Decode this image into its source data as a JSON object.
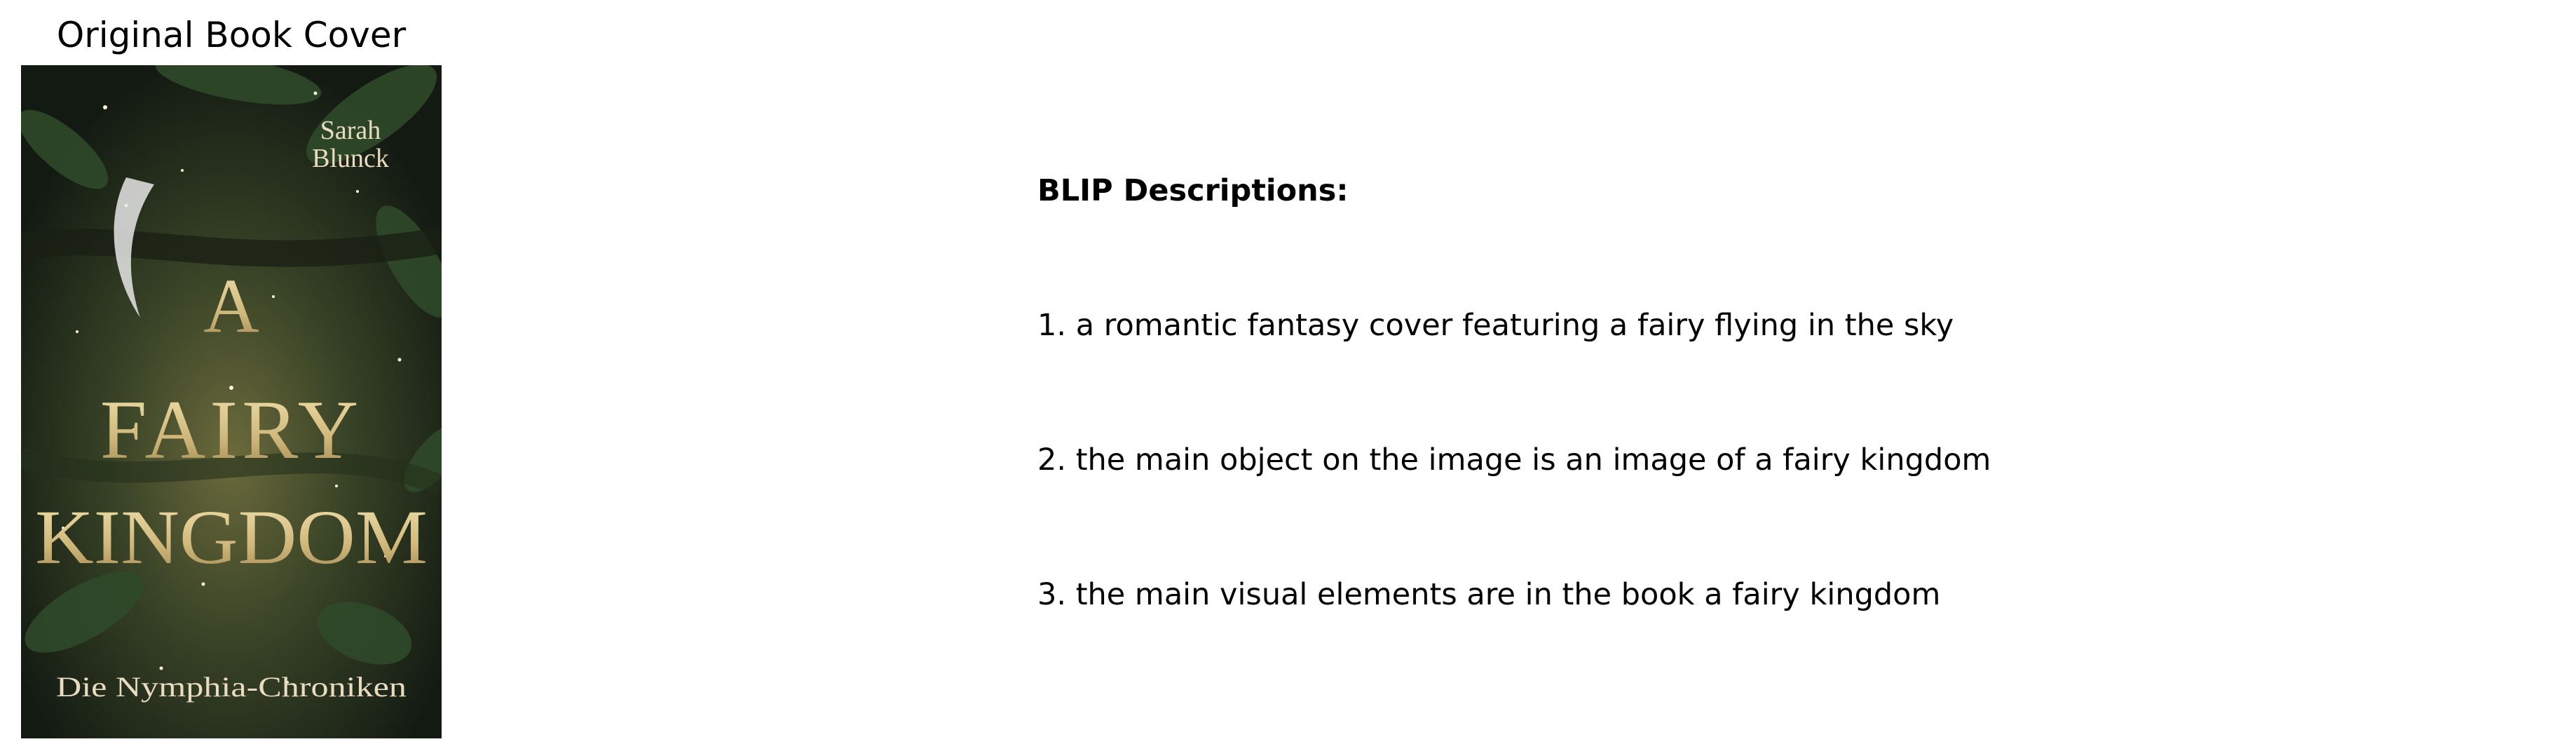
{
  "cover_panel": {
    "title": "Original Book Cover",
    "cover": {
      "author": "Sarah Blunck",
      "title_lines": [
        "A",
        "FAIRY",
        "KINGDOM"
      ],
      "series": "Die Nymphia-Chroniken"
    }
  },
  "descriptions": {
    "heading": "BLIP Descriptions:",
    "items": [
      "1. a romantic fantasy cover featuring a fairy flying in the sky",
      "2. the main object on the image is an image of a fairy kingdom",
      "3. the main visual elements are in the book a fairy kingdom"
    ]
  },
  "colors": {
    "cover_bg": "#1f2a1c",
    "cover_gold": "#d8c48a",
    "leaf": "#2f4a2a"
  }
}
